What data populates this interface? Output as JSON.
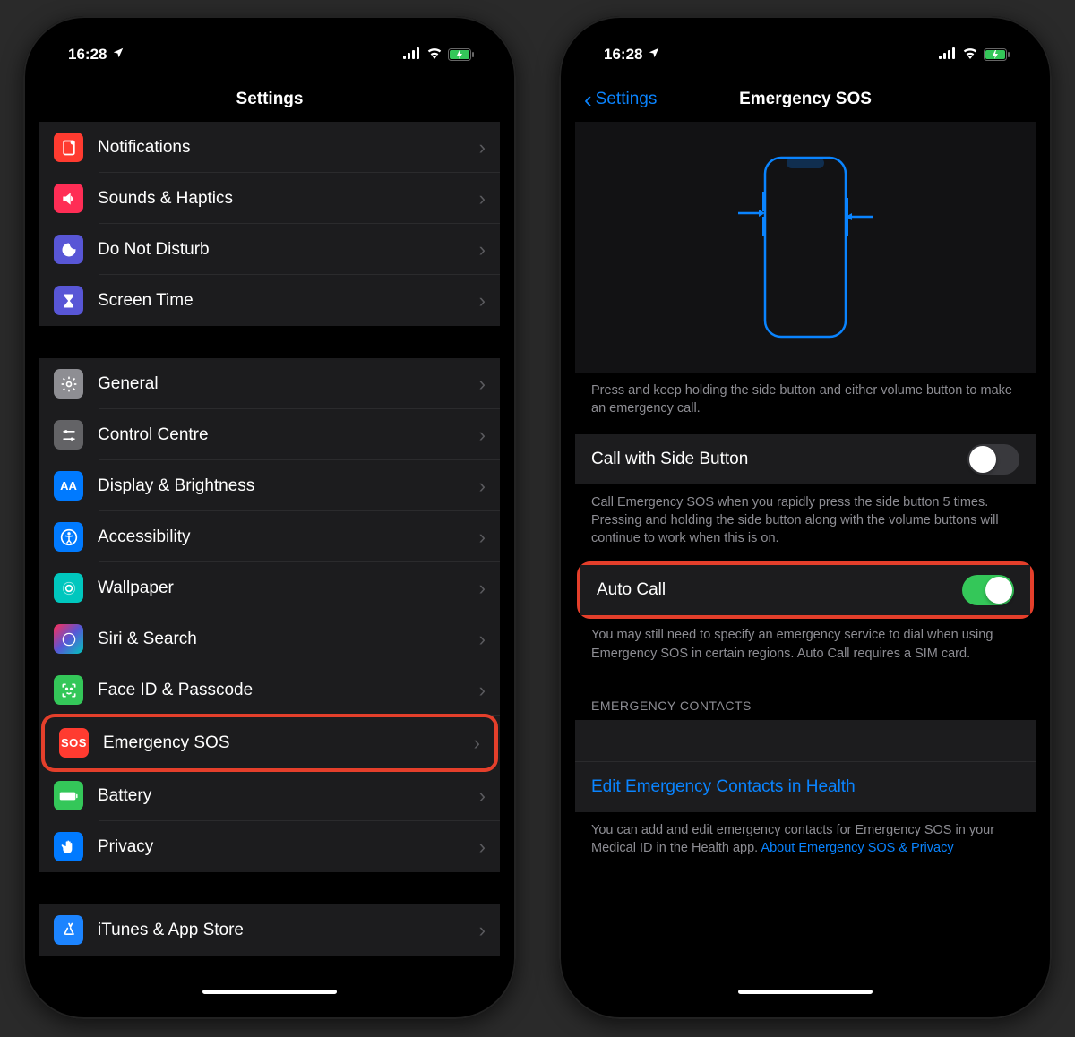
{
  "status": {
    "time": "16:28",
    "battery_charging": true
  },
  "left": {
    "title": "Settings",
    "group1": [
      {
        "label": "Notifications",
        "icon": "notifications-icon",
        "bg": "bg-red"
      },
      {
        "label": "Sounds & Haptics",
        "icon": "sounds-icon",
        "bg": "bg-pink"
      },
      {
        "label": "Do Not Disturb",
        "icon": "dnd-icon",
        "bg": "bg-purple"
      },
      {
        "label": "Screen Time",
        "icon": "screentime-icon",
        "bg": "bg-indigo"
      }
    ],
    "group2": [
      {
        "label": "General",
        "icon": "gear-icon",
        "bg": "bg-gray"
      },
      {
        "label": "Control Centre",
        "icon": "control-centre-icon",
        "bg": "bg-gray2"
      },
      {
        "label": "Display & Brightness",
        "icon": "display-icon",
        "bg": "bg-blue"
      },
      {
        "label": "Accessibility",
        "icon": "accessibility-icon",
        "bg": "bg-blue"
      },
      {
        "label": "Wallpaper",
        "icon": "wallpaper-icon",
        "bg": "bg-teal"
      },
      {
        "label": "Siri & Search",
        "icon": "siri-icon",
        "bg": "bg-siri"
      },
      {
        "label": "Face ID & Passcode",
        "icon": "faceid-icon",
        "bg": "bg-green"
      },
      {
        "label": "Emergency SOS",
        "icon": "sos-icon",
        "bg": "bg-sos",
        "highlight": true
      },
      {
        "label": "Battery",
        "icon": "battery-icon",
        "bg": "bg-green"
      },
      {
        "label": "Privacy",
        "icon": "privacy-icon",
        "bg": "bg-hand"
      }
    ],
    "group3": [
      {
        "label": "iTunes & App Store",
        "icon": "appstore-icon",
        "bg": "bg-astore"
      }
    ]
  },
  "right": {
    "back": "Settings",
    "title": "Emergency SOS",
    "illustration_help": "Press and keep holding the side button and either volume button to make an emergency call.",
    "call_side_label": "Call with Side Button",
    "call_side_on": false,
    "call_side_help": "Call Emergency SOS when you rapidly press the side button 5 times. Pressing and holding the side button along with the volume buttons will continue to work when this is on.",
    "auto_call_label": "Auto Call",
    "auto_call_on": true,
    "auto_call_help": "You may still need to specify an emergency service to dial when using Emergency SOS in certain regions. Auto Call requires a SIM card.",
    "contacts_header": "EMERGENCY CONTACTS",
    "edit_link": "Edit Emergency Contacts in Health",
    "contacts_help": "You can add and edit emergency contacts for Emergency SOS in your Medical ID in the Health app.",
    "privacy_link": "About Emergency SOS & Privacy"
  }
}
